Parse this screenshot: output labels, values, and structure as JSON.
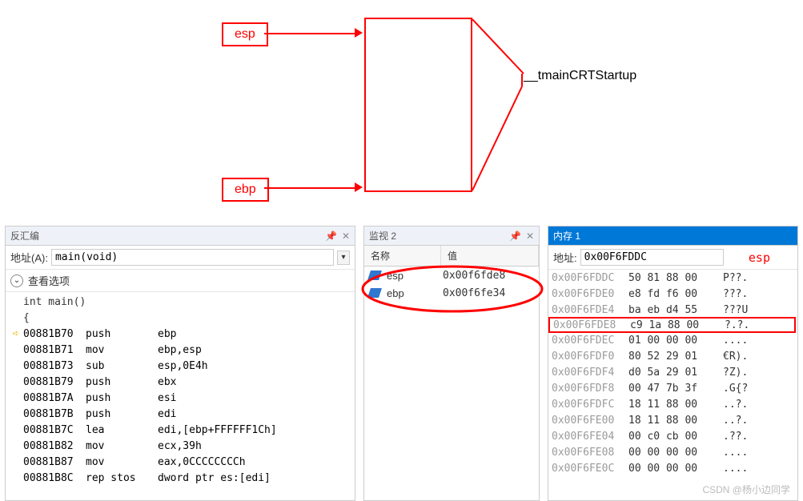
{
  "diagram": {
    "esp_label": "esp",
    "ebp_label": "ebp",
    "func_label": "__tmainCRTStartup"
  },
  "disasm_panel": {
    "title": "反汇编",
    "addr_label": "地址(A):",
    "addr_value": "main(void)",
    "view_options": "查看选项",
    "lines": [
      {
        "gutter": "",
        "text": "int main()",
        "mnem": "",
        "oper": ""
      },
      {
        "gutter": "",
        "text": "{",
        "mnem": "",
        "oper": ""
      },
      {
        "gutter": "ip",
        "addr": "00881B70",
        "mnem": "push",
        "oper": "ebp"
      },
      {
        "gutter": "",
        "addr": "00881B71",
        "mnem": "mov",
        "oper": "ebp,esp"
      },
      {
        "gutter": "",
        "addr": "00881B73",
        "mnem": "sub",
        "oper": "esp,0E4h"
      },
      {
        "gutter": "",
        "addr": "00881B79",
        "mnem": "push",
        "oper": "ebx"
      },
      {
        "gutter": "",
        "addr": "00881B7A",
        "mnem": "push",
        "oper": "esi"
      },
      {
        "gutter": "",
        "addr": "00881B7B",
        "mnem": "push",
        "oper": "edi"
      },
      {
        "gutter": "",
        "addr": "00881B7C",
        "mnem": "lea",
        "oper": "edi,[ebp+FFFFFF1Ch]"
      },
      {
        "gutter": "",
        "addr": "00881B82",
        "mnem": "mov",
        "oper": "ecx,39h"
      },
      {
        "gutter": "",
        "addr": "00881B87",
        "mnem": "mov",
        "oper": "eax,0CCCCCCCCh"
      },
      {
        "gutter": "",
        "addr": "00881B8C",
        "mnem": "rep stos",
        "oper": "dword ptr es:[edi]"
      }
    ]
  },
  "watch_panel": {
    "title": "监视 2",
    "col_name": "名称",
    "col_value": "值",
    "rows": [
      {
        "name": "esp",
        "value": "0x00f6fde8"
      },
      {
        "name": "ebp",
        "value": "0x00f6fe34"
      }
    ]
  },
  "mem_panel": {
    "title": "内存 1",
    "addr_label": "地址:",
    "addr_value": "0x00F6FDDC",
    "esp_tag": "esp",
    "rows": [
      {
        "addr": "0x00F6FDDC",
        "bytes": "50 81 88 00",
        "ascii": "P??.",
        "hl": false
      },
      {
        "addr": "0x00F6FDE0",
        "bytes": "e8 fd f6 00",
        "ascii": "???.",
        "hl": false
      },
      {
        "addr": "0x00F6FDE4",
        "bytes": "ba eb d4 55",
        "ascii": "???U",
        "hl": false
      },
      {
        "addr": "0x00F6FDE8",
        "bytes": "c9 1a 88 00",
        "ascii": "?.?.",
        "hl": true
      },
      {
        "addr": "0x00F6FDEC",
        "bytes": "01 00 00 00",
        "ascii": "....",
        "hl": false
      },
      {
        "addr": "0x00F6FDF0",
        "bytes": "80 52 29 01",
        "ascii": "€R).",
        "hl": false
      },
      {
        "addr": "0x00F6FDF4",
        "bytes": "d0 5a 29 01",
        "ascii": "?Z).",
        "hl": false
      },
      {
        "addr": "0x00F6FDF8",
        "bytes": "00 47 7b 3f",
        "ascii": ".G{?",
        "hl": false
      },
      {
        "addr": "0x00F6FDFC",
        "bytes": "18 11 88 00",
        "ascii": "..?.",
        "hl": false
      },
      {
        "addr": "0x00F6FE00",
        "bytes": "18 11 88 00",
        "ascii": "..?.",
        "hl": false
      },
      {
        "addr": "0x00F6FE04",
        "bytes": "00 c0 cb 00",
        "ascii": ".??.",
        "hl": false
      },
      {
        "addr": "0x00F6FE08",
        "bytes": "00 00 00 00",
        "ascii": "....",
        "hl": false
      },
      {
        "addr": "0x00F6FE0C",
        "bytes": "00 00 00 00",
        "ascii": "....",
        "hl": false
      }
    ]
  },
  "watermark": "CSDN @杨小边同学"
}
